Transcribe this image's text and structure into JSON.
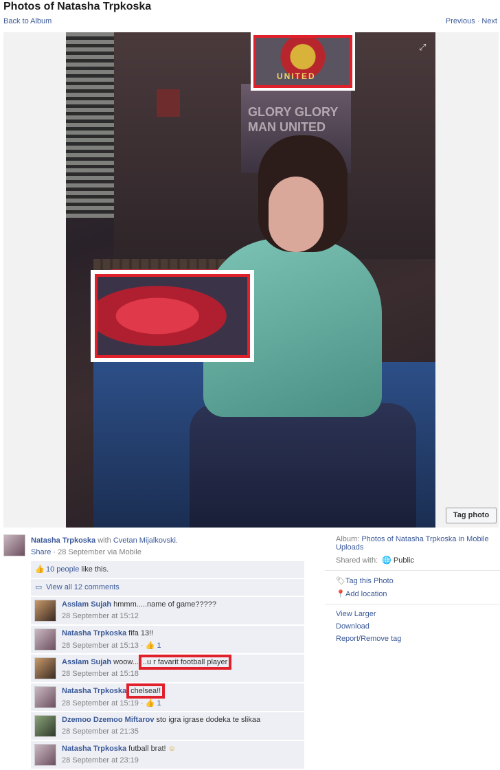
{
  "header": {
    "title": "Photos of Natasha Trpkoska",
    "back_label": "Back to Album",
    "previous_label": "Previous",
    "separator": "·",
    "next_label": "Next"
  },
  "photo": {
    "poster_text": "GLORY GLORY MAN UNITED",
    "crest_text": "UNITED",
    "tag_photo_label": "Tag photo"
  },
  "owner": {
    "name": "Natasha Trpkoska",
    "with_text": "with",
    "with_name": "Cvetan Mijalkovski.",
    "share_label": "Share",
    "meta": "· 28 September via Mobile"
  },
  "feedback": {
    "likes_link": "10 people",
    "likes_suffix": "like this.",
    "view_all": "View all 12 comments"
  },
  "comments": [
    {
      "author": "Asslam Sujah",
      "text": "hmmm.....name of game?????",
      "time": "28 September at 15:12",
      "likes": ""
    },
    {
      "author": "Natasha Trpkoska",
      "text": "fifa 13!!",
      "time": "28 September at 15:13 ·",
      "likes": "1"
    },
    {
      "author": "Asslam Sujah",
      "text_pre": "woow...",
      "text_hl": "..u r favarit football player",
      "time": "28 September at 15:18",
      "likes": ""
    },
    {
      "author": "Natasha Trpkoska",
      "text_hl": "chelsea!!",
      "time": "28 September at 15:19 ·",
      "likes": "1"
    },
    {
      "author": "Dzemoo Dzemoo Miftarov",
      "text": "sto igra igrase dodeka te slikaa",
      "time": "28 September at 21:35",
      "likes": ""
    },
    {
      "author": "Natasha Trpkoska",
      "text": "futball brat!",
      "time": "28 September at 23:19",
      "likes": ""
    }
  ],
  "sidebar": {
    "album_label": "Album:",
    "album_name": "Photos of Natasha Trpkoska in Mobile Uploads",
    "shared_label": "Shared with:",
    "shared_value": "Public",
    "tag_this_photo": "Tag this Photo",
    "add_location": "Add location",
    "view_larger": "View Larger",
    "download": "Download",
    "report": "Report/Remove tag"
  },
  "colors": {
    "link": "#3b5998",
    "highlight_red": "#e0202a",
    "comment_bg": "#edeff4"
  }
}
